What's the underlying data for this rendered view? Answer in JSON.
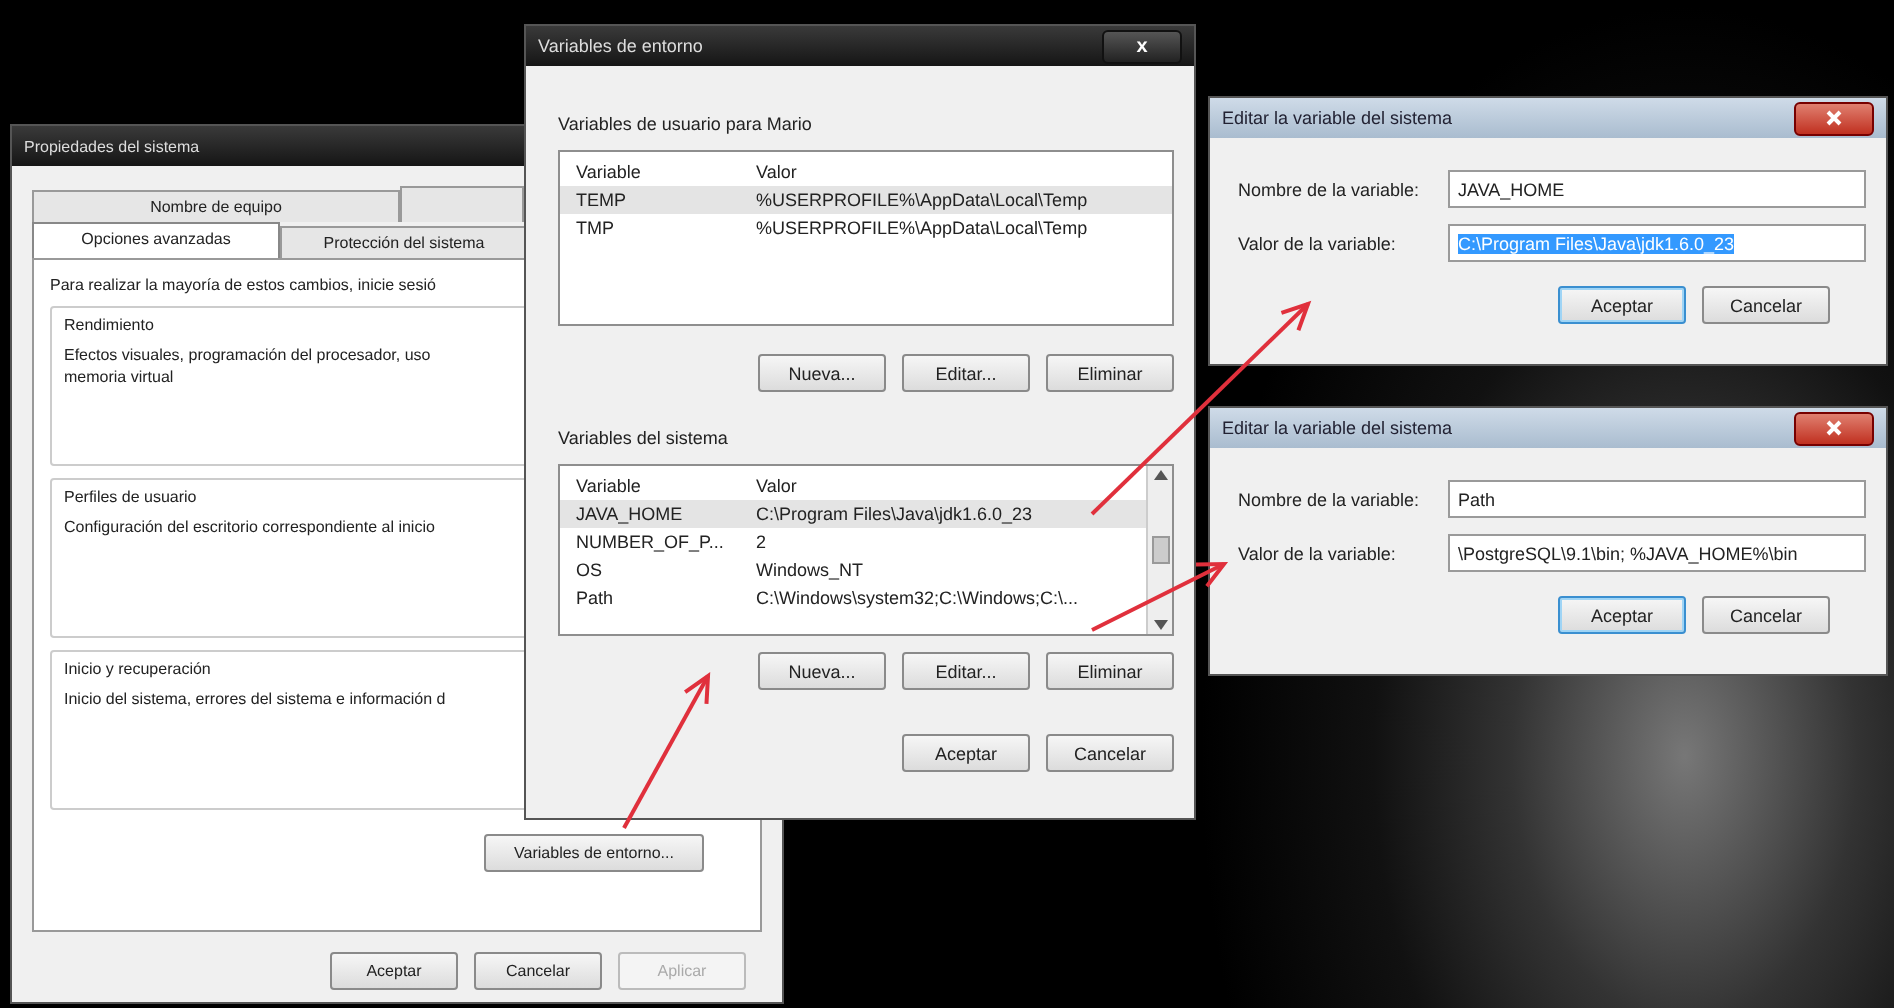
{
  "system_properties": {
    "title": "Propiedades del sistema",
    "tabs_row_1": [
      {
        "label": "Nombre de equipo",
        "selected": false
      }
    ],
    "tabs_row_2": [
      {
        "label": "Opciones avanzadas",
        "selected": true
      },
      {
        "label": "Protección del sistema",
        "selected": false
      }
    ],
    "intro": "Para realizar la mayoría de estos cambios, inicie sesió",
    "groups": [
      {
        "title": "Rendimiento",
        "text": "Efectos visuales, programación del procesador, uso\nmemoria virtual"
      },
      {
        "title": "Perfiles de usuario",
        "text": "Configuración del escritorio correspondiente al inicio"
      },
      {
        "title": "Inicio y recuperación",
        "text": "Inicio del sistema, errores del sistema e información d"
      }
    ],
    "env_button": "Variables de entorno...",
    "buttons": [
      {
        "label": "Aceptar",
        "disabled": false
      },
      {
        "label": "Cancelar",
        "disabled": false
      },
      {
        "label": "Aplicar",
        "disabled": true
      }
    ]
  },
  "environment_variables": {
    "title": "Variables de entorno",
    "close": "x",
    "user_section": {
      "title": "Variables de usuario para Mario",
      "columns": [
        "Variable",
        "Valor"
      ],
      "rows": [
        {
          "name": "TEMP",
          "value": "%USERPROFILE%\\AppData\\Local\\Temp",
          "selected": true
        },
        {
          "name": "TMP",
          "value": "%USERPROFILE%\\AppData\\Local\\Temp",
          "selected": false
        }
      ],
      "buttons": [
        "Nueva...",
        "Editar...",
        "Eliminar"
      ]
    },
    "system_section": {
      "title": "Variables del sistema",
      "columns": [
        "Variable",
        "Valor"
      ],
      "rows": [
        {
          "name": "JAVA_HOME",
          "value": "C:\\Program Files\\Java\\jdk1.6.0_23",
          "selected": true
        },
        {
          "name": "NUMBER_OF_P...",
          "value": "2",
          "selected": false
        },
        {
          "name": "OS",
          "value": "Windows_NT",
          "selected": false
        },
        {
          "name": "Path",
          "value": "C:\\Windows\\system32;C:\\Windows;C:\\...",
          "selected": false
        }
      ],
      "buttons": [
        "Nueva...",
        "Editar...",
        "Eliminar"
      ]
    },
    "buttons": [
      "Aceptar",
      "Cancelar"
    ]
  },
  "edit_dialogs": [
    {
      "title": "Editar la variable del sistema",
      "fields": [
        {
          "label": "Nombre de la variable:",
          "value": "JAVA_HOME",
          "selected": false
        },
        {
          "label": "Valor de la variable:",
          "value": "C:\\Program Files\\Java\\jdk1.6.0_23",
          "selected": true
        }
      ],
      "buttons": [
        {
          "label": "Aceptar",
          "default": true
        },
        {
          "label": "Cancelar",
          "default": false
        }
      ]
    },
    {
      "title": "Editar la variable del sistema",
      "fields": [
        {
          "label": "Nombre de la variable:",
          "value": "Path",
          "selected": false
        },
        {
          "label": "Valor de la variable:",
          "value": "\\PostgreSQL\\9.1\\bin; %JAVA_HOME%\\bin",
          "selected": false
        }
      ],
      "buttons": [
        {
          "label": "Aceptar",
          "default": true
        },
        {
          "label": "Cancelar",
          "default": false
        }
      ]
    }
  ]
}
